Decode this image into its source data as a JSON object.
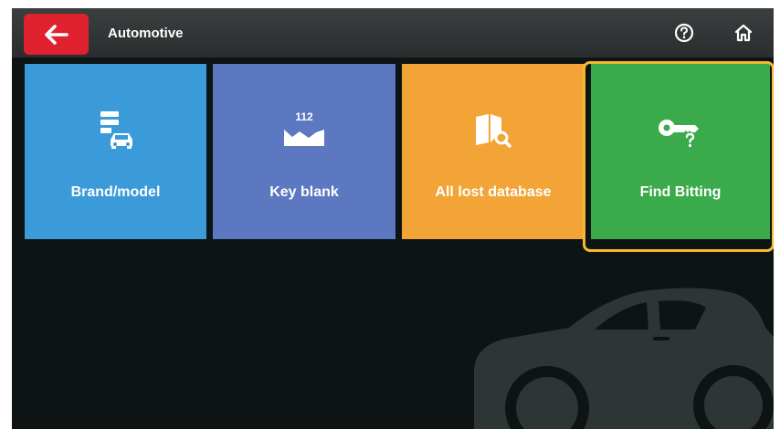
{
  "header": {
    "back_icon": "arrow-left-icon",
    "title": "Automotive",
    "help_icon": "help-icon",
    "home_icon": "home-icon"
  },
  "tiles": [
    {
      "label": "Brand/model",
      "icon": "car-database-icon",
      "color": "#3b9bd9"
    },
    {
      "label": "Key blank",
      "icon": "key-blank-icon",
      "color": "#5b78c1",
      "icon_text": "112"
    },
    {
      "label": "All lost database",
      "icon": "book-search-icon",
      "color": "#f3a436"
    },
    {
      "label": "Find Bitting",
      "icon": "key-question-icon",
      "color": "#3aaa4b",
      "selected": true
    }
  ],
  "colors": {
    "back_button": "#e0212e",
    "highlight": "#f4b92d",
    "background": "#0e1414"
  }
}
